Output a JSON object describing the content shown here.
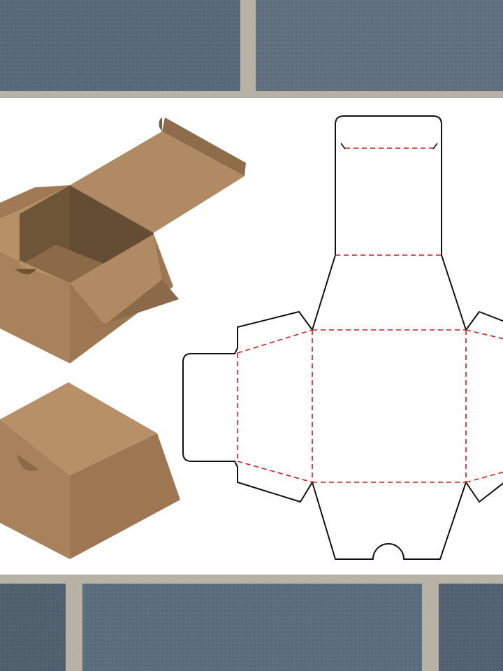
{
  "colors": {
    "cardboard_light": "#b89068",
    "cardboard_mid": "#a8825c",
    "cardboard_dark": "#8a6a48",
    "cardboard_inner": "#6f5538",
    "cut_line": "#111111",
    "fold_line": "#d01818",
    "paper": "#ffffff",
    "stone": "#5c6d7c",
    "mortar": "#b8b2a6"
  },
  "illustrations": [
    {
      "name": "open-box",
      "state": "open"
    },
    {
      "name": "closed-box",
      "state": "closed"
    }
  ],
  "dieline": {
    "cut_style": "solid",
    "fold_style": "dashed"
  }
}
